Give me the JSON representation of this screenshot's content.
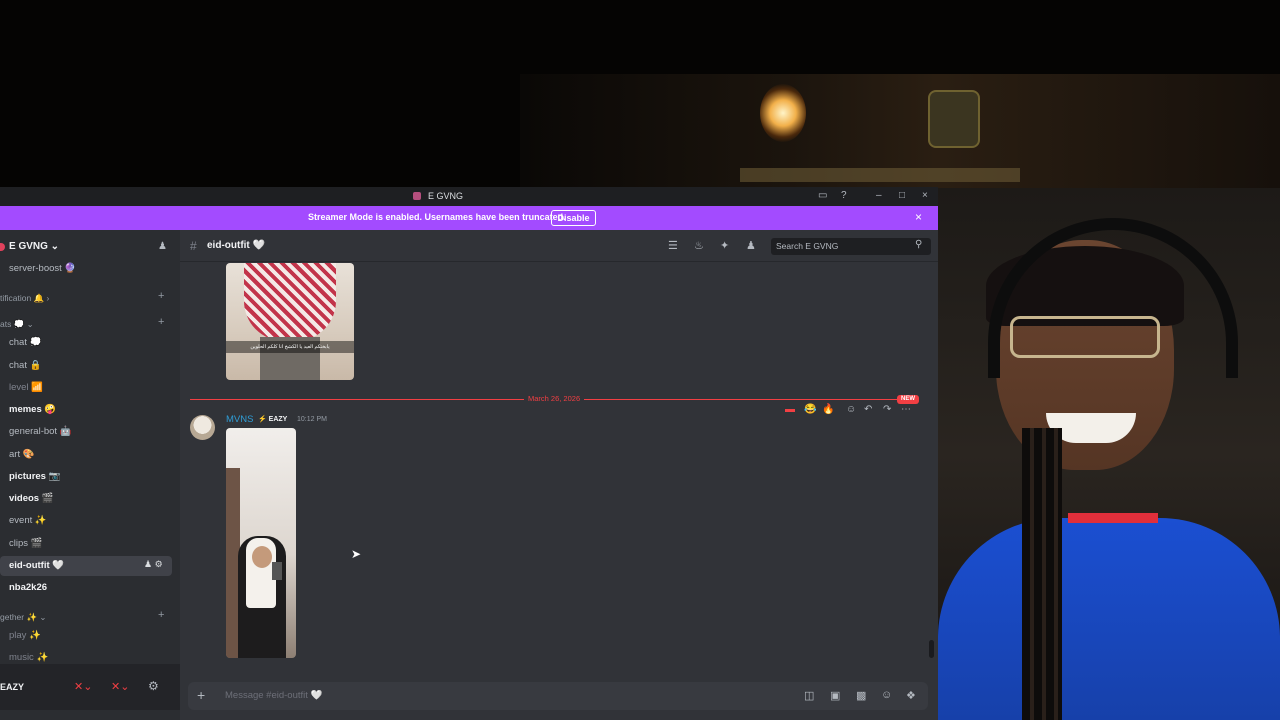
{
  "window": {
    "title": "E GVNG",
    "controls": [
      "▭",
      "?",
      "–",
      "□",
      "×"
    ]
  },
  "banner": {
    "text": "Streamer Mode is enabled. Usernames have been truncated.",
    "disable_label": "Disable",
    "close": "×"
  },
  "sidebar": {
    "server_name": "E GVNG ⌄",
    "channels": [
      {
        "label": "server-boost 🔮"
      },
      {
        "label": "chat 💭"
      },
      {
        "label": "chat 🔒"
      },
      {
        "label": "level 📶"
      },
      {
        "label": "memes 🤪"
      },
      {
        "label": "general-bot 🤖"
      },
      {
        "label": "art 🎨"
      },
      {
        "label": "pictures 📷"
      },
      {
        "label": "videos 🎬"
      },
      {
        "label": "event ✨"
      },
      {
        "label": "clips 🎬"
      },
      {
        "label": "eid-outfit 🤍"
      },
      {
        "label": "nba2k26"
      },
      {
        "label": "play ✨"
      },
      {
        "label": "music ✨"
      }
    ],
    "categories": [
      {
        "label": "tification 🔔 ›"
      },
      {
        "label": "ats 💭 ⌄"
      },
      {
        "label": "gether ✨ ⌄"
      }
    ],
    "user": {
      "name": "EAZY"
    }
  },
  "header": {
    "channel": "eid-outfit 🤍",
    "search_placeholder": "Search E GVNG"
  },
  "messages": {
    "image1_caption": "يابختكم العيد يا الكشخ انا كلكم الحلوين",
    "date_divider": "March 26, 2026",
    "new_badge": "NEW",
    "author": "MVNS",
    "author_tag": "EAZY",
    "time": "10:12 PM"
  },
  "composer": {
    "placeholder": "Message #eid-outfit 🤍"
  }
}
